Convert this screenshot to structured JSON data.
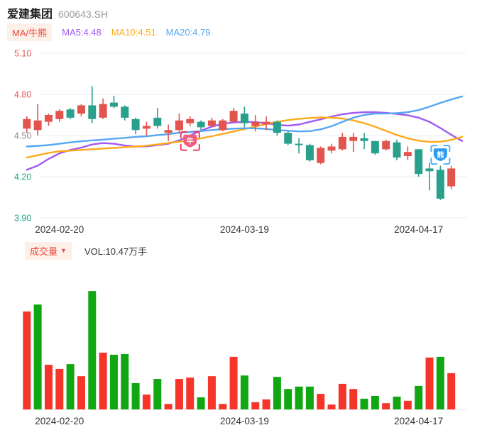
{
  "header": {
    "title": "爱建集团",
    "code": "600643.SH"
  },
  "legend": {
    "toggle_label": "MA/牛熊",
    "items": [
      {
        "label": "MA5:4.48",
        "color": "#a15af2"
      },
      {
        "label": "MA10:4.51",
        "color": "#fcaa1b"
      },
      {
        "label": "MA20:4.79",
        "color": "#56a6f3"
      }
    ]
  },
  "volume_header": {
    "selector_label": "成交量",
    "caret": "▼",
    "value_label": "VOL:10.47万手"
  },
  "colors": {
    "candle_up": "#e2544e",
    "candle_down": "#28a08c",
    "vol_up": "#f5352a",
    "vol_down": "#11a713",
    "grid": "#e9eef4",
    "baseline": "#e0e0e0",
    "tick_red": "#e45757",
    "tick_gray": "#8e8e8e",
    "tick_green": "#1fa384",
    "date_label": "#333333"
  },
  "chart_data": {
    "type": "candlestick",
    "title": "爱建集团 600643.SH",
    "y_ticks": [
      {
        "value": "5.10",
        "price": 5.1,
        "color": "#e45757"
      },
      {
        "value": "4.80",
        "price": 4.8,
        "color": "#e45757"
      },
      {
        "value": "4.50",
        "price": 4.5,
        "color": "#8e8e8e"
      },
      {
        "value": "4.20",
        "price": 4.2,
        "color": "#1fa384"
      },
      {
        "value": "3.90",
        "price": 3.9,
        "color": "#1fa384"
      }
    ],
    "ylim": [
      3.9,
      5.1
    ],
    "x_ticks": [
      {
        "index": 3,
        "label": "2024-02-20"
      },
      {
        "index": 20,
        "label": "2024-03-19"
      },
      {
        "index": 36,
        "label": "2024-04-17"
      }
    ],
    "candles_ohlc_note": "each candle is [open, close, high, low]; red when close>=open, teal-green when close<open",
    "candles": [
      [
        4.55,
        4.62,
        4.64,
        4.52
      ],
      [
        4.54,
        4.61,
        4.73,
        4.5
      ],
      [
        4.6,
        4.65,
        4.66,
        4.57
      ],
      [
        4.62,
        4.68,
        4.69,
        4.6
      ],
      [
        4.69,
        4.63,
        4.7,
        4.62
      ],
      [
        4.66,
        4.72,
        4.73,
        4.64
      ],
      [
        4.72,
        4.62,
        4.86,
        4.59
      ],
      [
        4.63,
        4.73,
        4.77,
        4.62
      ],
      [
        4.74,
        4.71,
        4.79,
        4.7
      ],
      [
        4.71,
        4.63,
        4.72,
        4.61
      ],
      [
        4.62,
        4.54,
        4.63,
        4.51
      ],
      [
        4.55,
        4.57,
        4.6,
        4.5
      ],
      [
        4.63,
        4.57,
        4.7,
        4.55
      ],
      [
        4.52,
        4.54,
        4.58,
        4.46
      ],
      [
        4.54,
        4.61,
        4.66,
        4.52
      ],
      [
        4.59,
        4.62,
        4.64,
        4.57
      ],
      [
        4.6,
        4.56,
        4.61,
        4.54
      ],
      [
        4.57,
        4.61,
        4.63,
        4.56
      ],
      [
        4.54,
        4.61,
        4.62,
        4.53
      ],
      [
        4.6,
        4.68,
        4.7,
        4.59
      ],
      [
        4.66,
        4.59,
        4.71,
        4.56
      ],
      [
        4.57,
        4.6,
        4.65,
        4.53
      ],
      [
        4.58,
        4.6,
        4.64,
        4.54
      ],
      [
        4.6,
        4.52,
        4.61,
        4.5
      ],
      [
        4.52,
        4.44,
        4.53,
        4.43
      ],
      [
        4.44,
        4.43,
        4.48,
        4.37
      ],
      [
        4.43,
        4.32,
        4.44,
        4.31
      ],
      [
        4.3,
        4.41,
        4.42,
        4.29
      ],
      [
        4.39,
        4.42,
        4.44,
        4.37
      ],
      [
        4.4,
        4.49,
        4.52,
        4.39
      ],
      [
        4.46,
        4.49,
        4.52,
        4.38
      ],
      [
        4.48,
        4.46,
        4.52,
        4.4
      ],
      [
        4.46,
        4.37,
        4.46,
        4.36
      ],
      [
        4.4,
        4.46,
        4.47,
        4.39
      ],
      [
        4.45,
        4.34,
        4.47,
        4.32
      ],
      [
        4.35,
        4.38,
        4.42,
        4.32
      ],
      [
        4.4,
        4.22,
        4.4,
        4.2
      ],
      [
        4.26,
        4.24,
        4.3,
        4.1
      ],
      [
        4.25,
        4.04,
        4.28,
        4.03
      ],
      [
        4.13,
        4.26,
        4.28,
        4.11
      ]
    ],
    "ma_lines": [
      {
        "name": "MA5",
        "color": "#a15af2",
        "values": [
          4.25,
          4.28,
          4.33,
          4.37,
          4.395,
          4.412,
          4.435,
          4.445,
          4.44,
          4.427,
          4.42,
          4.421,
          4.43,
          4.44,
          4.465,
          4.5,
          4.535,
          4.565,
          4.585,
          4.595,
          4.6,
          4.598,
          4.59,
          4.578,
          4.572,
          4.58,
          4.6,
          4.618,
          4.638,
          4.655,
          4.665,
          4.67,
          4.67,
          4.665,
          4.658,
          4.648,
          4.63,
          4.6,
          4.555,
          4.505,
          4.46
        ]
      },
      {
        "name": "MA10",
        "color": "#fcaa1b",
        "values": [
          4.34,
          4.356,
          4.374,
          4.385,
          4.39,
          4.395,
          4.4,
          4.405,
          4.41,
          4.415,
          4.42,
          4.426,
          4.435,
          4.445,
          4.455,
          4.466,
          4.48,
          4.495,
          4.512,
          4.53,
          4.547,
          4.565,
          4.585,
          4.6,
          4.612,
          4.622,
          4.628,
          4.632,
          4.63,
          4.624,
          4.61,
          4.59,
          4.564,
          4.534,
          4.504,
          4.48,
          4.462,
          4.454,
          4.455,
          4.468,
          4.49
        ]
      },
      {
        "name": "MA20",
        "color": "#56a6f3",
        "values": [
          4.42,
          4.425,
          4.43,
          4.44,
          4.45,
          4.458,
          4.465,
          4.47,
          4.477,
          4.483,
          4.49,
          4.495,
          4.503,
          4.51,
          4.52,
          4.526,
          4.532,
          4.54,
          4.546,
          4.55,
          4.553,
          4.553,
          4.548,
          4.54,
          4.535,
          4.53,
          4.532,
          4.545,
          4.568,
          4.6,
          4.63,
          4.65,
          4.66,
          4.66,
          4.663,
          4.67,
          4.685,
          4.71,
          4.738,
          4.763,
          4.785
        ]
      }
    ],
    "markers": [
      {
        "name": "bull-marker",
        "glyph": "牛",
        "index": 15,
        "price": 4.46,
        "fill": "#f25d7d",
        "bracket": "#f23b60"
      },
      {
        "name": "bear-marker",
        "glyph": "熊",
        "index": 38,
        "price": 4.36,
        "fill": "#2d9cf5",
        "bracket": "#55aef7"
      }
    ],
    "volume": {
      "unit": "万手",
      "latest_label": "VOL:10.47万手",
      "values": [
        28.3,
        30.3,
        12.9,
        11.7,
        13.1,
        9.6,
        34.2,
        16.4,
        15.8,
        16.0,
        7.6,
        4.3,
        8.8,
        1.6,
        8.8,
        9.2,
        3.5,
        9.6,
        1.6,
        15.2,
        9.8,
        2.1,
        2.9,
        9.4,
        5.9,
        6.6,
        6.6,
        4.5,
        1.4,
        7.4,
        5.9,
        3.1,
        3.9,
        1.8,
        3.7,
        2.5,
        6.8,
        15.0,
        15.2,
        10.47
      ],
      "colors": [
        "r",
        "g",
        "r",
        "r",
        "g",
        "r",
        "g",
        "r",
        "g",
        "g",
        "g",
        "r",
        "g",
        "r",
        "r",
        "r",
        "g",
        "r",
        "r",
        "r",
        "g",
        "r",
        "r",
        "g",
        "g",
        "g",
        "g",
        "r",
        "r",
        "r",
        "r",
        "g",
        "g",
        "r",
        "g",
        "r",
        "g",
        "r",
        "g",
        "r"
      ]
    }
  }
}
